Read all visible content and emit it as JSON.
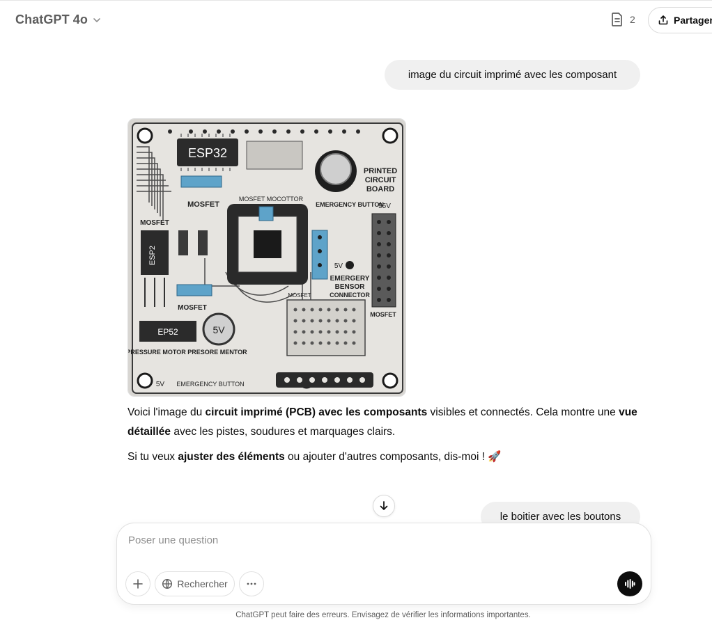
{
  "header": {
    "model_name": "ChatGPT 4o",
    "canvas_count": "2",
    "share_label": "Partager"
  },
  "messages": [
    {
      "role": "user",
      "text": "image du circuit imprimé avec les composant"
    },
    {
      "role": "assistant",
      "image_labels": {
        "chip_main": "ESP32",
        "chip_left": "ESP2",
        "chip_bottom": "EP52",
        "mosfet1": "MOSFET",
        "mosfet2": "MOSFET",
        "mosfet3": "MOSFET",
        "mosfet4": "MOSFET",
        "mosfet5": "MOSFET",
        "motor": "MOSFET MOCOTTOR",
        "emergency_button": "EMERGENCY BUTTON",
        "printed1": "PRINTED",
        "printed2": "CIRCUIT",
        "printed3": "BOARD",
        "v55": "55V",
        "v5": "5V",
        "emergery1": "EMERGERY",
        "emergery2": "BENSOR",
        "emergery3": "CONNECTOR",
        "pressure": "PRESSURE MOTOR PRESORE MENTOR",
        "emergency_bottom": "EMERGENCY BUTTON",
        "bottom_5v": "5V",
        "cap_5v": "5V"
      },
      "p1_a": "Voici l'image du ",
      "p1_b": "circuit imprimé (PCB) avec les composants",
      "p1_c": " visibles et connectés. Cela montre une ",
      "p1_d": "vue détaillée",
      "p1_e": " avec les pistes, soudures et marquages clairs.",
      "p2_a": "Si tu veux ",
      "p2_b": "ajuster des éléments",
      "p2_c": " ou ajouter d'autres composants, dis-moi ! 🚀"
    },
    {
      "role": "user",
      "text": "le boitier avec les boutons"
    }
  ],
  "composer": {
    "placeholder": "Poser une question",
    "search_label": "Rechercher"
  },
  "footer": {
    "disclaimer": "ChatGPT peut faire des erreurs. Envisagez de vérifier les informations importantes."
  }
}
